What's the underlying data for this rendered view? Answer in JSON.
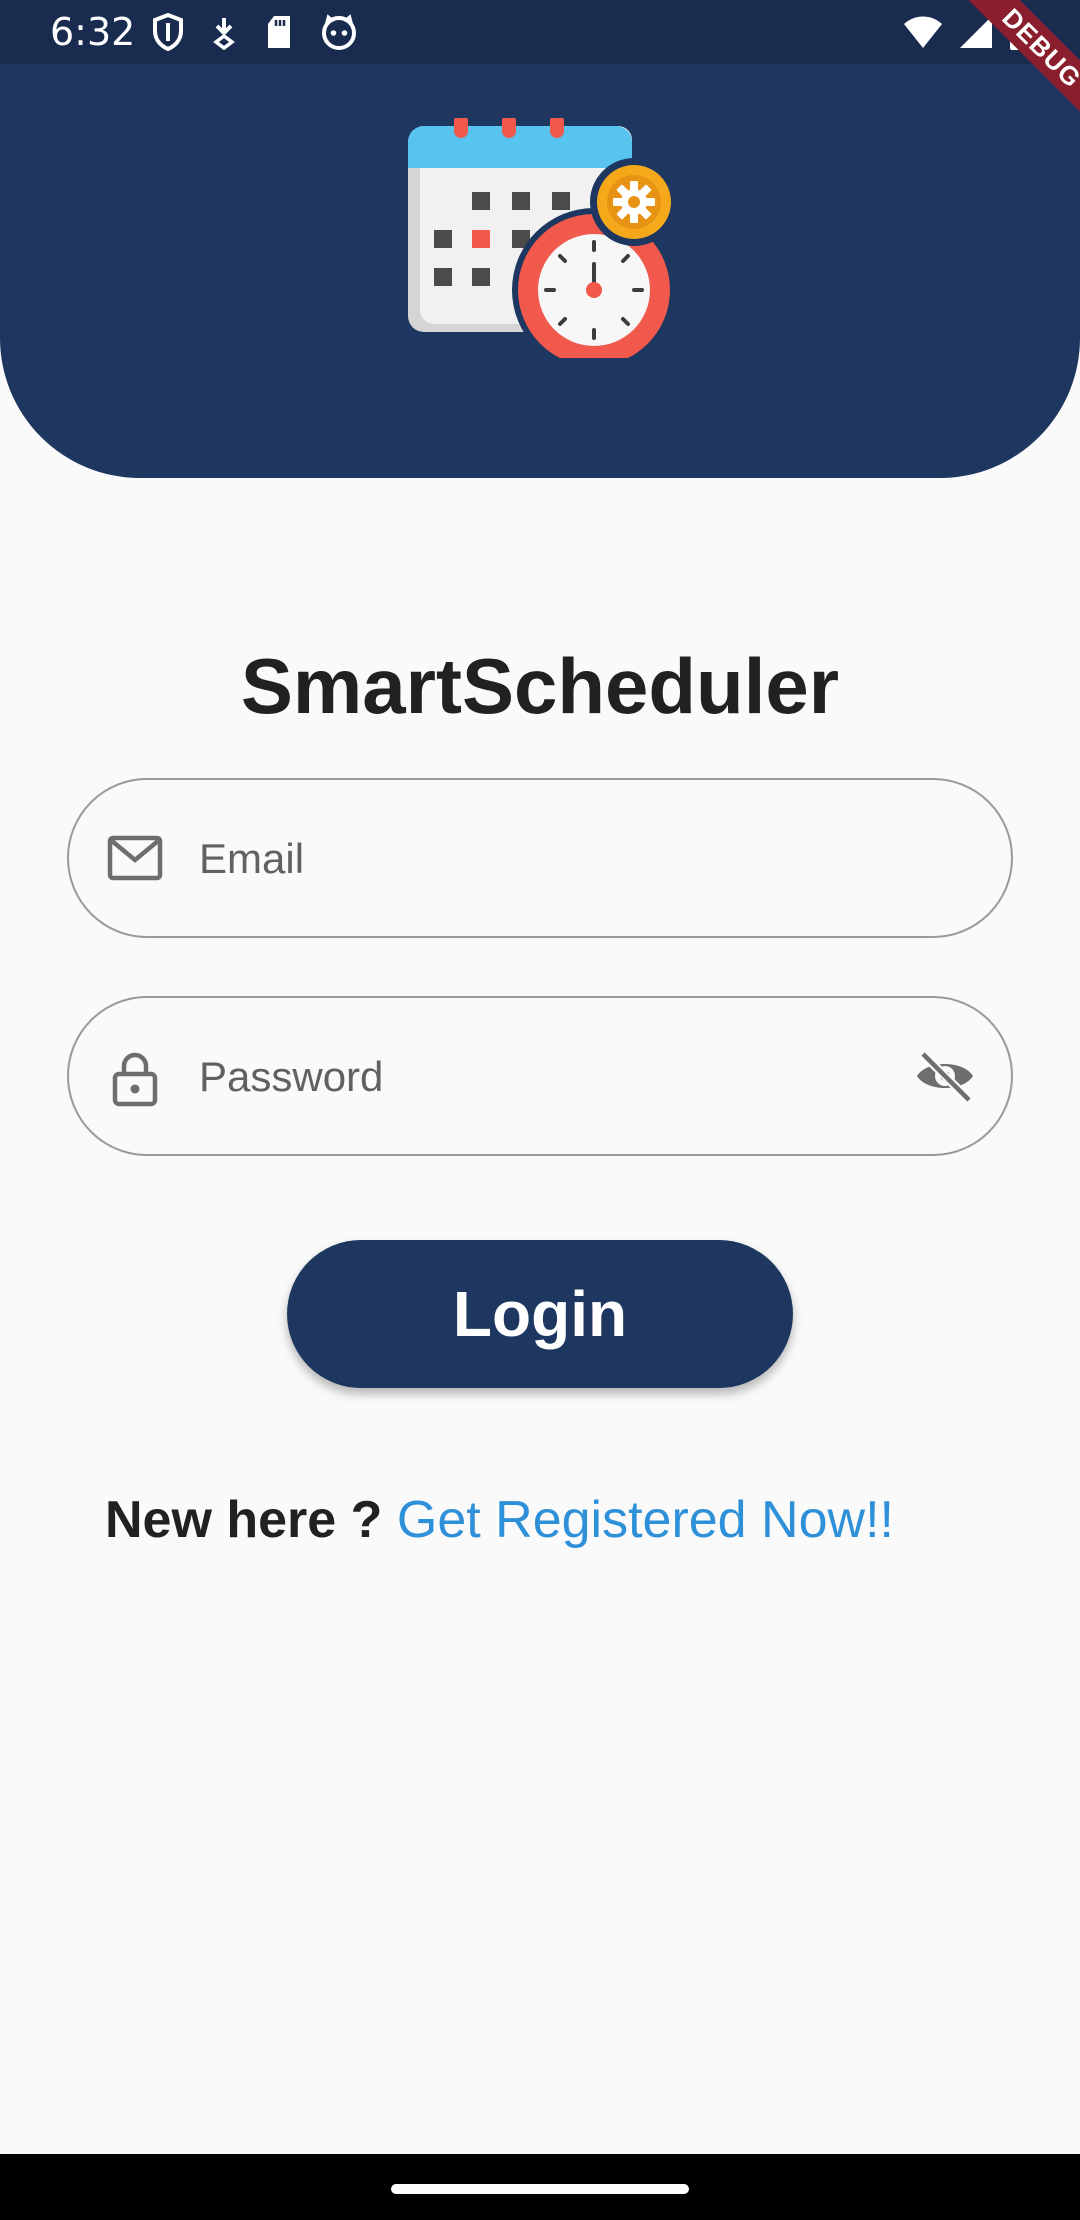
{
  "status_bar": {
    "time": "6:32",
    "left_icons": [
      "shield-icon",
      "download-icon",
      "sd-card-icon",
      "cat-icon"
    ],
    "right_icons": [
      "wifi-icon",
      "signal-icon",
      "battery-icon"
    ]
  },
  "debug_banner": "DEBUG",
  "app": {
    "logo_icon": "calendar-clock-icon",
    "title": "SmartScheduler"
  },
  "form": {
    "email": {
      "placeholder": "Email",
      "value": "",
      "icon": "mail-icon"
    },
    "password": {
      "placeholder": "Password",
      "value": "",
      "icon": "lock-icon",
      "toggle_icon": "visibility-off-icon"
    },
    "login_label": "Login"
  },
  "register": {
    "question": "New here ?",
    "link": "Get Registered Now!!"
  },
  "colors": {
    "primary": "#1d3760",
    "status_bar": "#192c50",
    "link": "#2f90da",
    "background": "#fafafa",
    "debug": "#8b1e2c"
  }
}
